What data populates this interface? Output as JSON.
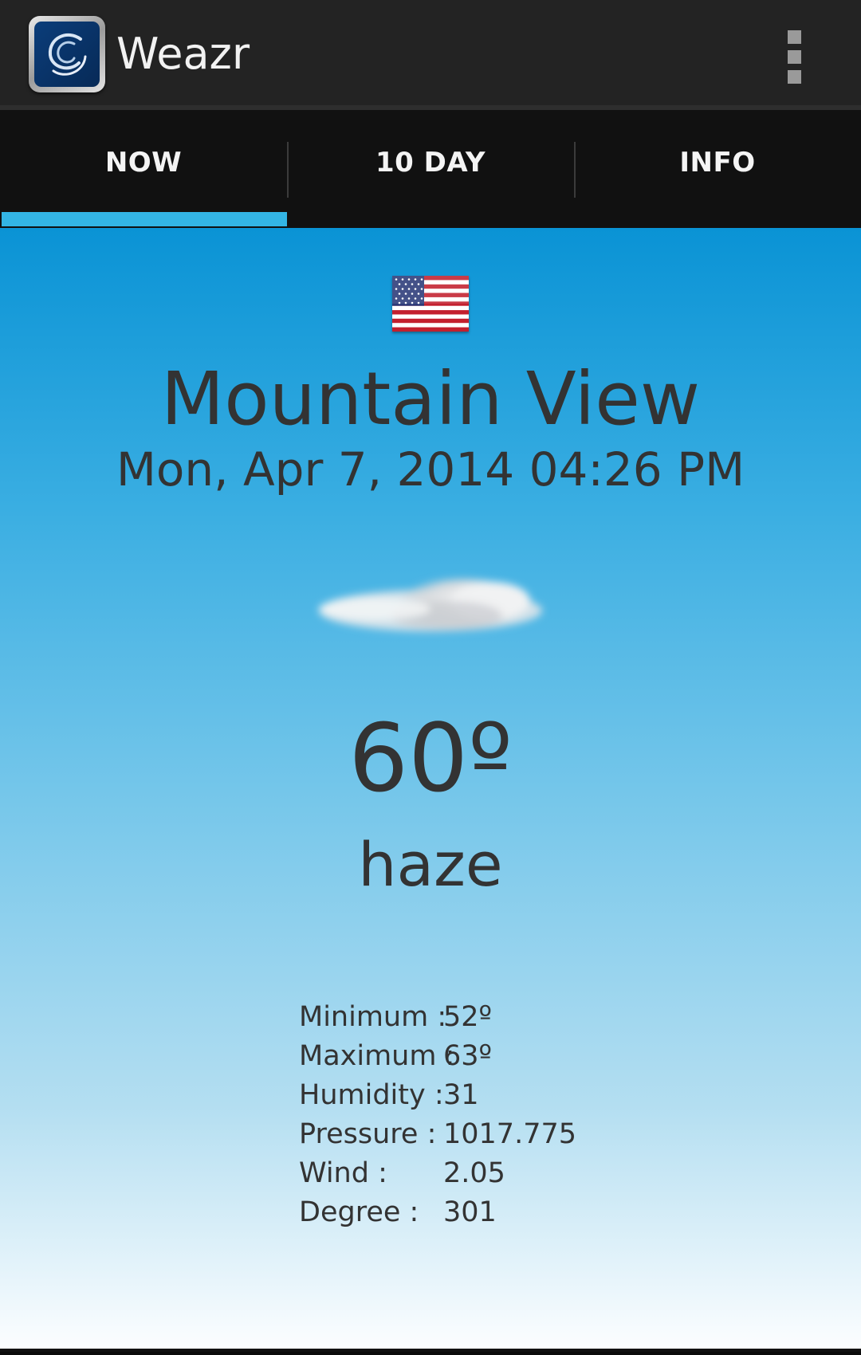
{
  "app": {
    "title": "Weazr",
    "icon": "weazr-swirl-icon"
  },
  "menu": {
    "icon": "overflow-menu-icon"
  },
  "tabs": [
    {
      "label": "NOW",
      "active": true
    },
    {
      "label": "10 DAY",
      "active": false
    },
    {
      "label": "INFO",
      "active": false
    }
  ],
  "colors": {
    "tab_indicator": "#33b5e5",
    "action_bar": "#232323",
    "text": "#333333",
    "sky_top": "#0a93d5",
    "sky_bottom": "#fdfeff"
  },
  "weather": {
    "country_flag": "us-flag-icon",
    "city": "Mountain View",
    "datetime": "Mon, Apr 7, 2014 04:26 PM",
    "condition_icon": "cloud-icon",
    "temperature": "60º",
    "condition": "haze",
    "details": [
      {
        "label": "Minimum :",
        "value": "52º"
      },
      {
        "label": "Maximum :",
        "value": "63º"
      },
      {
        "label": "Humidity :",
        "value": "31"
      },
      {
        "label": "Pressure :",
        "value": "1017.775"
      },
      {
        "label": "Wind :",
        "value": "2.05"
      },
      {
        "label": "Degree :",
        "value": "301"
      }
    ]
  }
}
